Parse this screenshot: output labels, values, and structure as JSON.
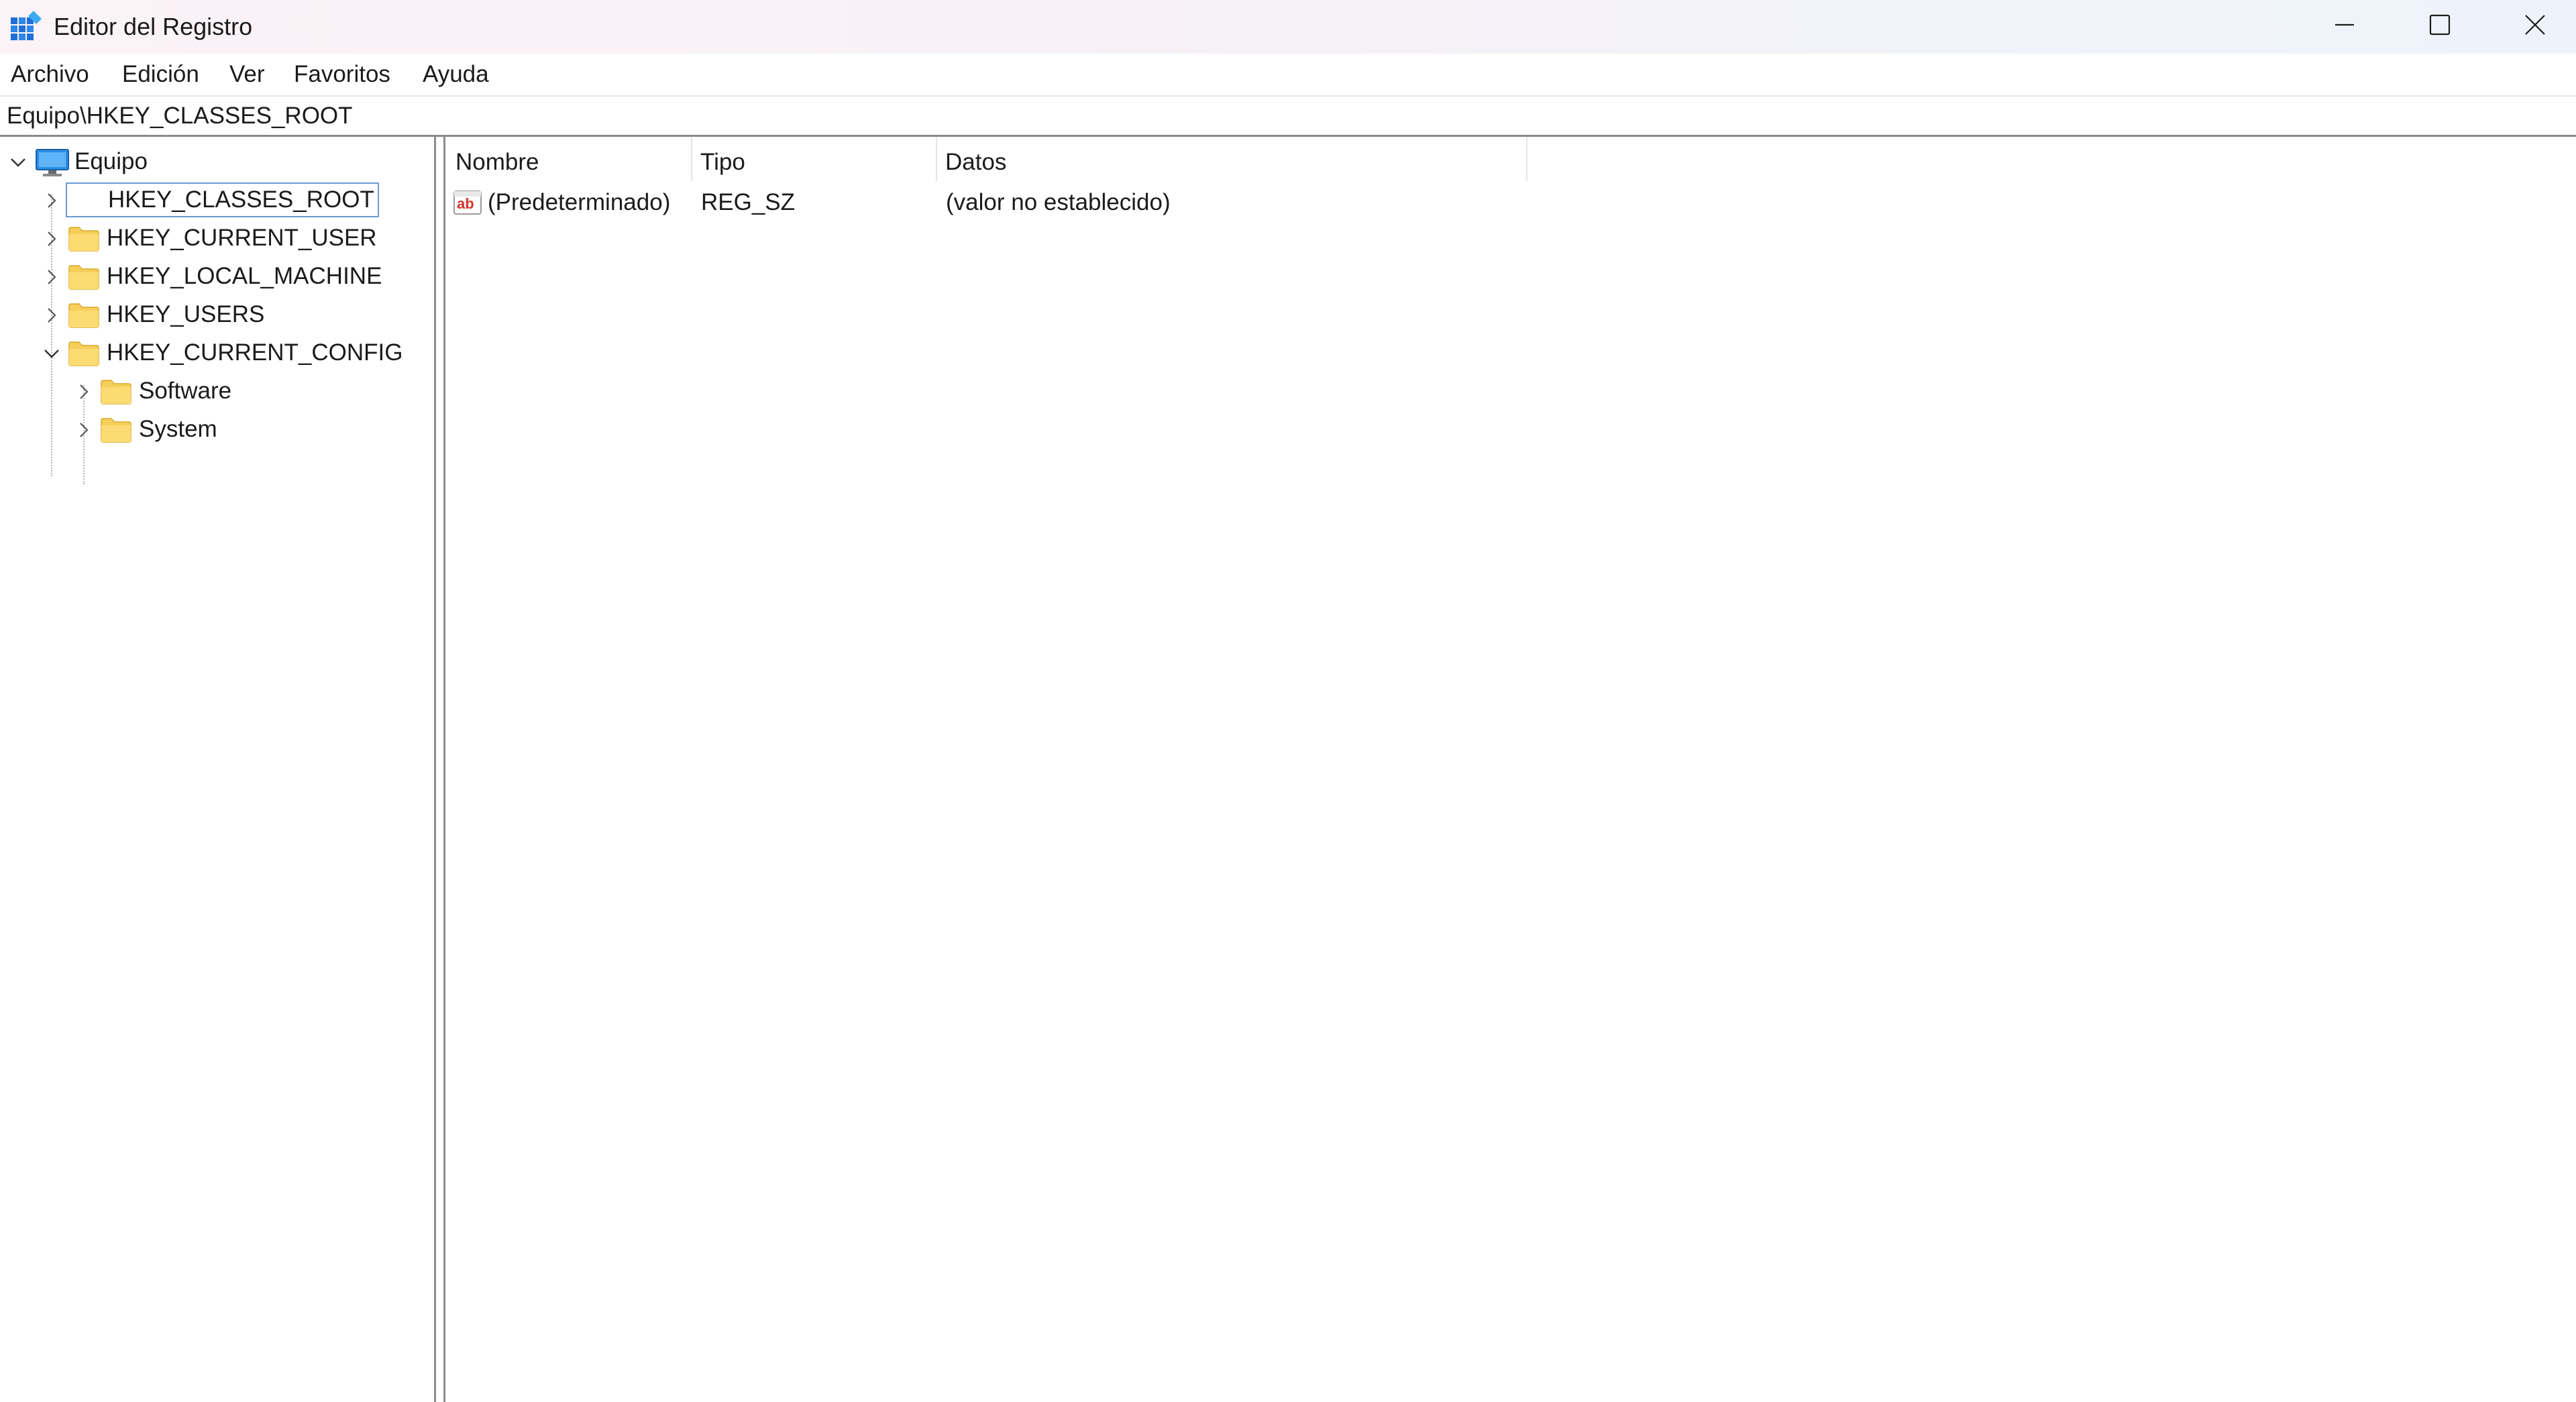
{
  "window": {
    "title": "Editor del Registro"
  },
  "menu": {
    "items": [
      "Archivo",
      "Edición",
      "Ver",
      "Favoritos",
      "Ayuda"
    ]
  },
  "address": {
    "path": "Equipo\\HKEY_CLASSES_ROOT"
  },
  "tree": {
    "root": "Equipo",
    "hives": [
      "HKEY_CLASSES_ROOT",
      "HKEY_CURRENT_USER",
      "HKEY_LOCAL_MACHINE",
      "HKEY_USERS",
      "HKEY_CURRENT_CONFIG"
    ],
    "selected": "HKEY_CLASSES_ROOT",
    "expanded": "HKEY_CURRENT_CONFIG",
    "children": [
      "Software",
      "System"
    ]
  },
  "list": {
    "columns": [
      "Nombre",
      "Tipo",
      "Datos"
    ],
    "rows": [
      {
        "name": "(Predeterminado)",
        "type": "REG_SZ",
        "data": "(valor no establecido)",
        "icon": "string-value-icon"
      }
    ]
  },
  "colors": {
    "selection_border": "#6b9bd1",
    "folder": "#f6cf5a"
  }
}
